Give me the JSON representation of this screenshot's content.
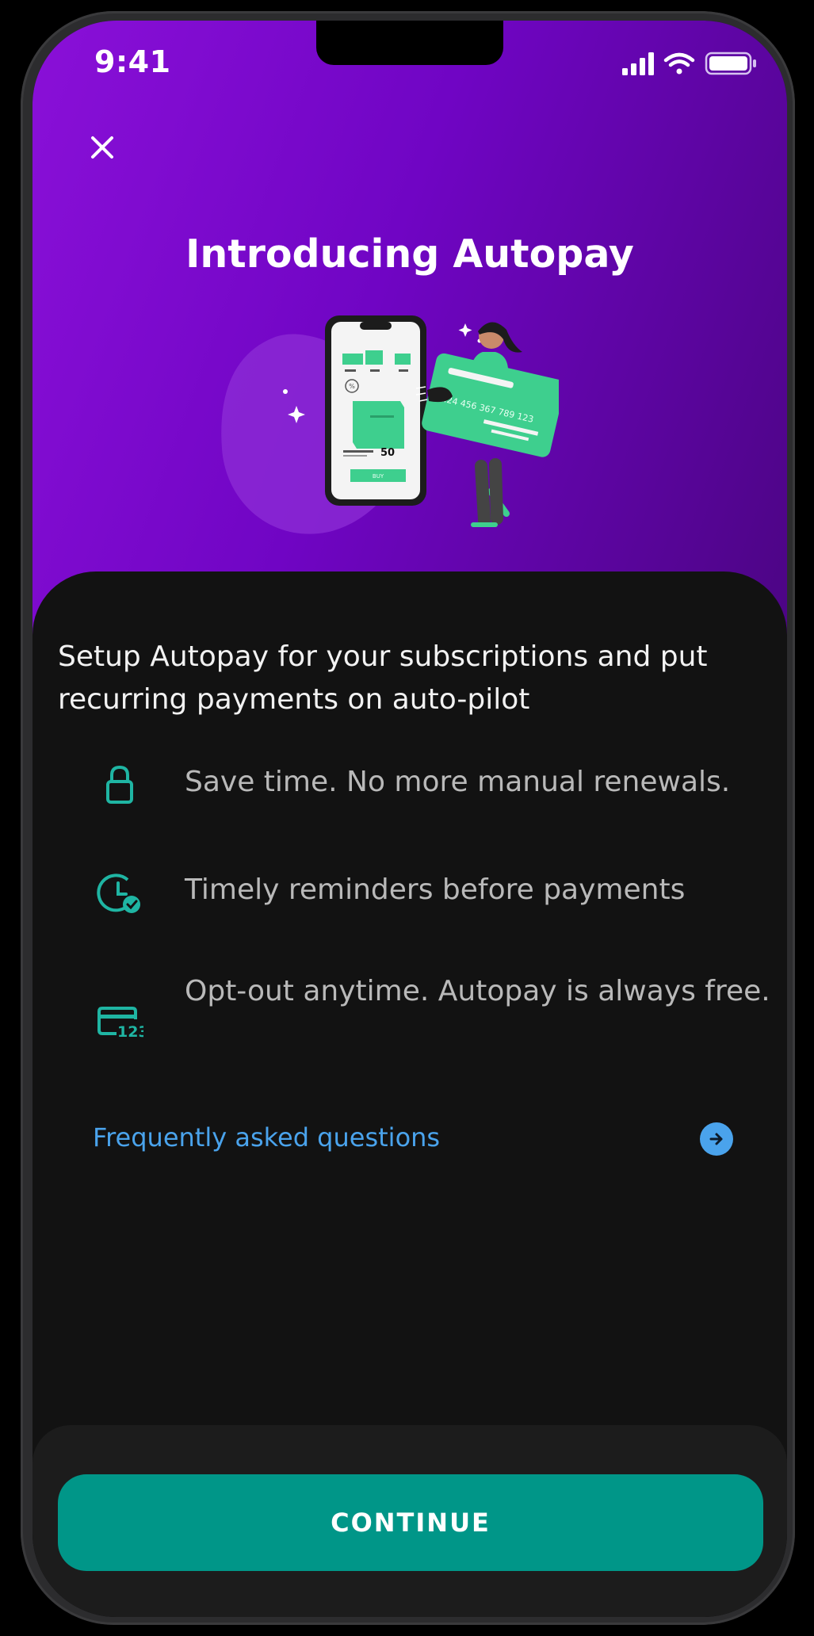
{
  "status_bar": {
    "time": "9:41"
  },
  "header": {
    "close_icon": "close-icon"
  },
  "hero": {
    "title": "Introducing Autopay",
    "illustration": {
      "phone_price": "50",
      "phone_button": "BUY",
      "card_number": "1.24 456 367 789 123"
    }
  },
  "intro": {
    "text": "Setup Autopay for your subscriptions and put recurring payments on auto-pilot"
  },
  "features": [
    {
      "icon": "lock-icon",
      "text": "Save time. No more manual renewals."
    },
    {
      "icon": "clock-check-icon",
      "text": "Timely reminders before payments"
    },
    {
      "icon": "card-123-icon",
      "text": "Opt-out anytime. Autopay is always free."
    }
  ],
  "faq": {
    "label": "Frequently asked questions",
    "icon": "arrow-right-circle-icon"
  },
  "footer": {
    "continue_label": "CONTINUE"
  },
  "colors": {
    "hero_start": "#8a10d8",
    "hero_end": "#4c0584",
    "accent_teal": "#009688",
    "icon_teal": "#1fb5a3",
    "link_blue": "#4aa3ec",
    "background": "#121212"
  }
}
